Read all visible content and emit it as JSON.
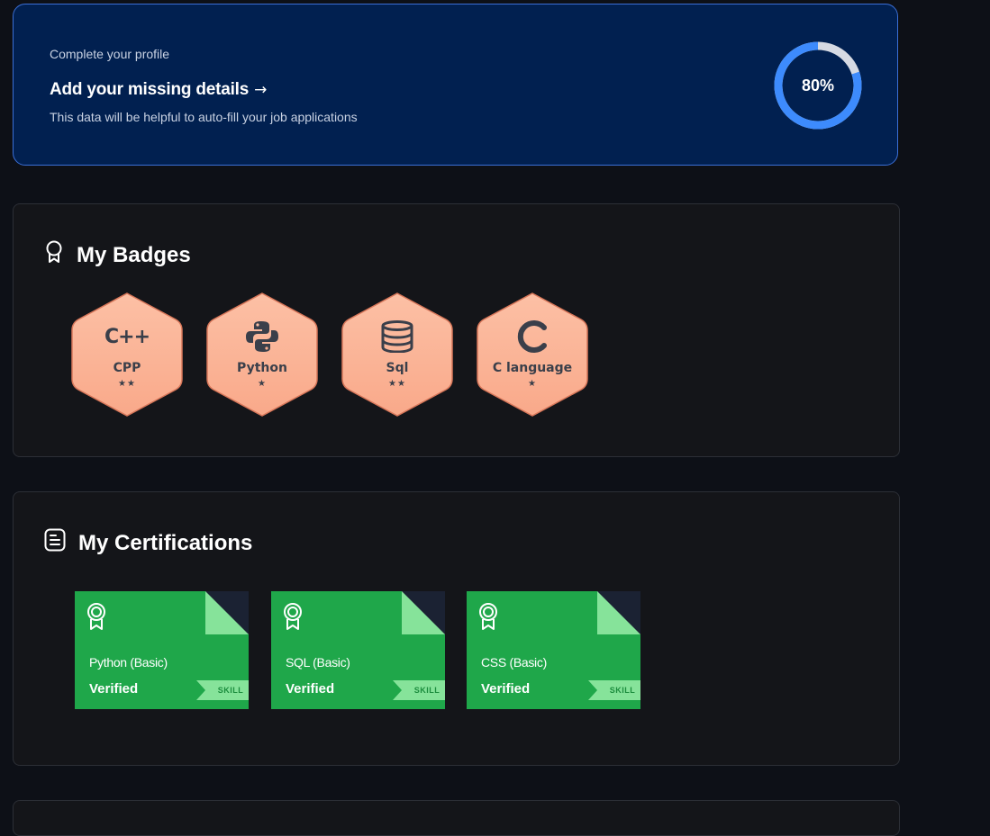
{
  "profile": {
    "eyebrow": "Complete your profile",
    "title": "Add your missing details",
    "arrow": "→",
    "subtitle": "This data will be helpful to auto-fill your job applications",
    "progress_label": "80%",
    "progress_value": 0.8,
    "colors": {
      "ring": "#3d8bfd",
      "ring_track": "#d6dae3",
      "card_bg": "#012050"
    }
  },
  "badges": {
    "heading": "My Badges",
    "heading_icon": "badge-ribbon-icon",
    "items": [
      {
        "name": "CPP",
        "stars": "★★",
        "icon": "cpp-icon"
      },
      {
        "name": "Python",
        "stars": "★",
        "icon": "python-icon"
      },
      {
        "name": "Sql",
        "stars": "★★",
        "icon": "database-icon"
      },
      {
        "name": "C language",
        "stars": "★",
        "icon": "c-language-icon"
      }
    ],
    "cpp_glyph": "C++",
    "colors": {
      "hex_top": "#fcc0a5",
      "hex_bottom": "#f9a98a",
      "hex_border": "#d8775a"
    }
  },
  "certifications": {
    "heading": "My Certifications",
    "heading_icon": "certificate-document-icon",
    "items": [
      {
        "name": "Python (Basic)",
        "status": "Verified",
        "tag": "SKILL"
      },
      {
        "name": "SQL (Basic)",
        "status": "Verified",
        "tag": "SKILL"
      },
      {
        "name": "CSS (Basic)",
        "status": "Verified",
        "tag": "SKILL"
      }
    ],
    "colors": {
      "card": "#1fa74a",
      "fold": "#86e39a",
      "tag_bg": "#86e39a"
    }
  }
}
